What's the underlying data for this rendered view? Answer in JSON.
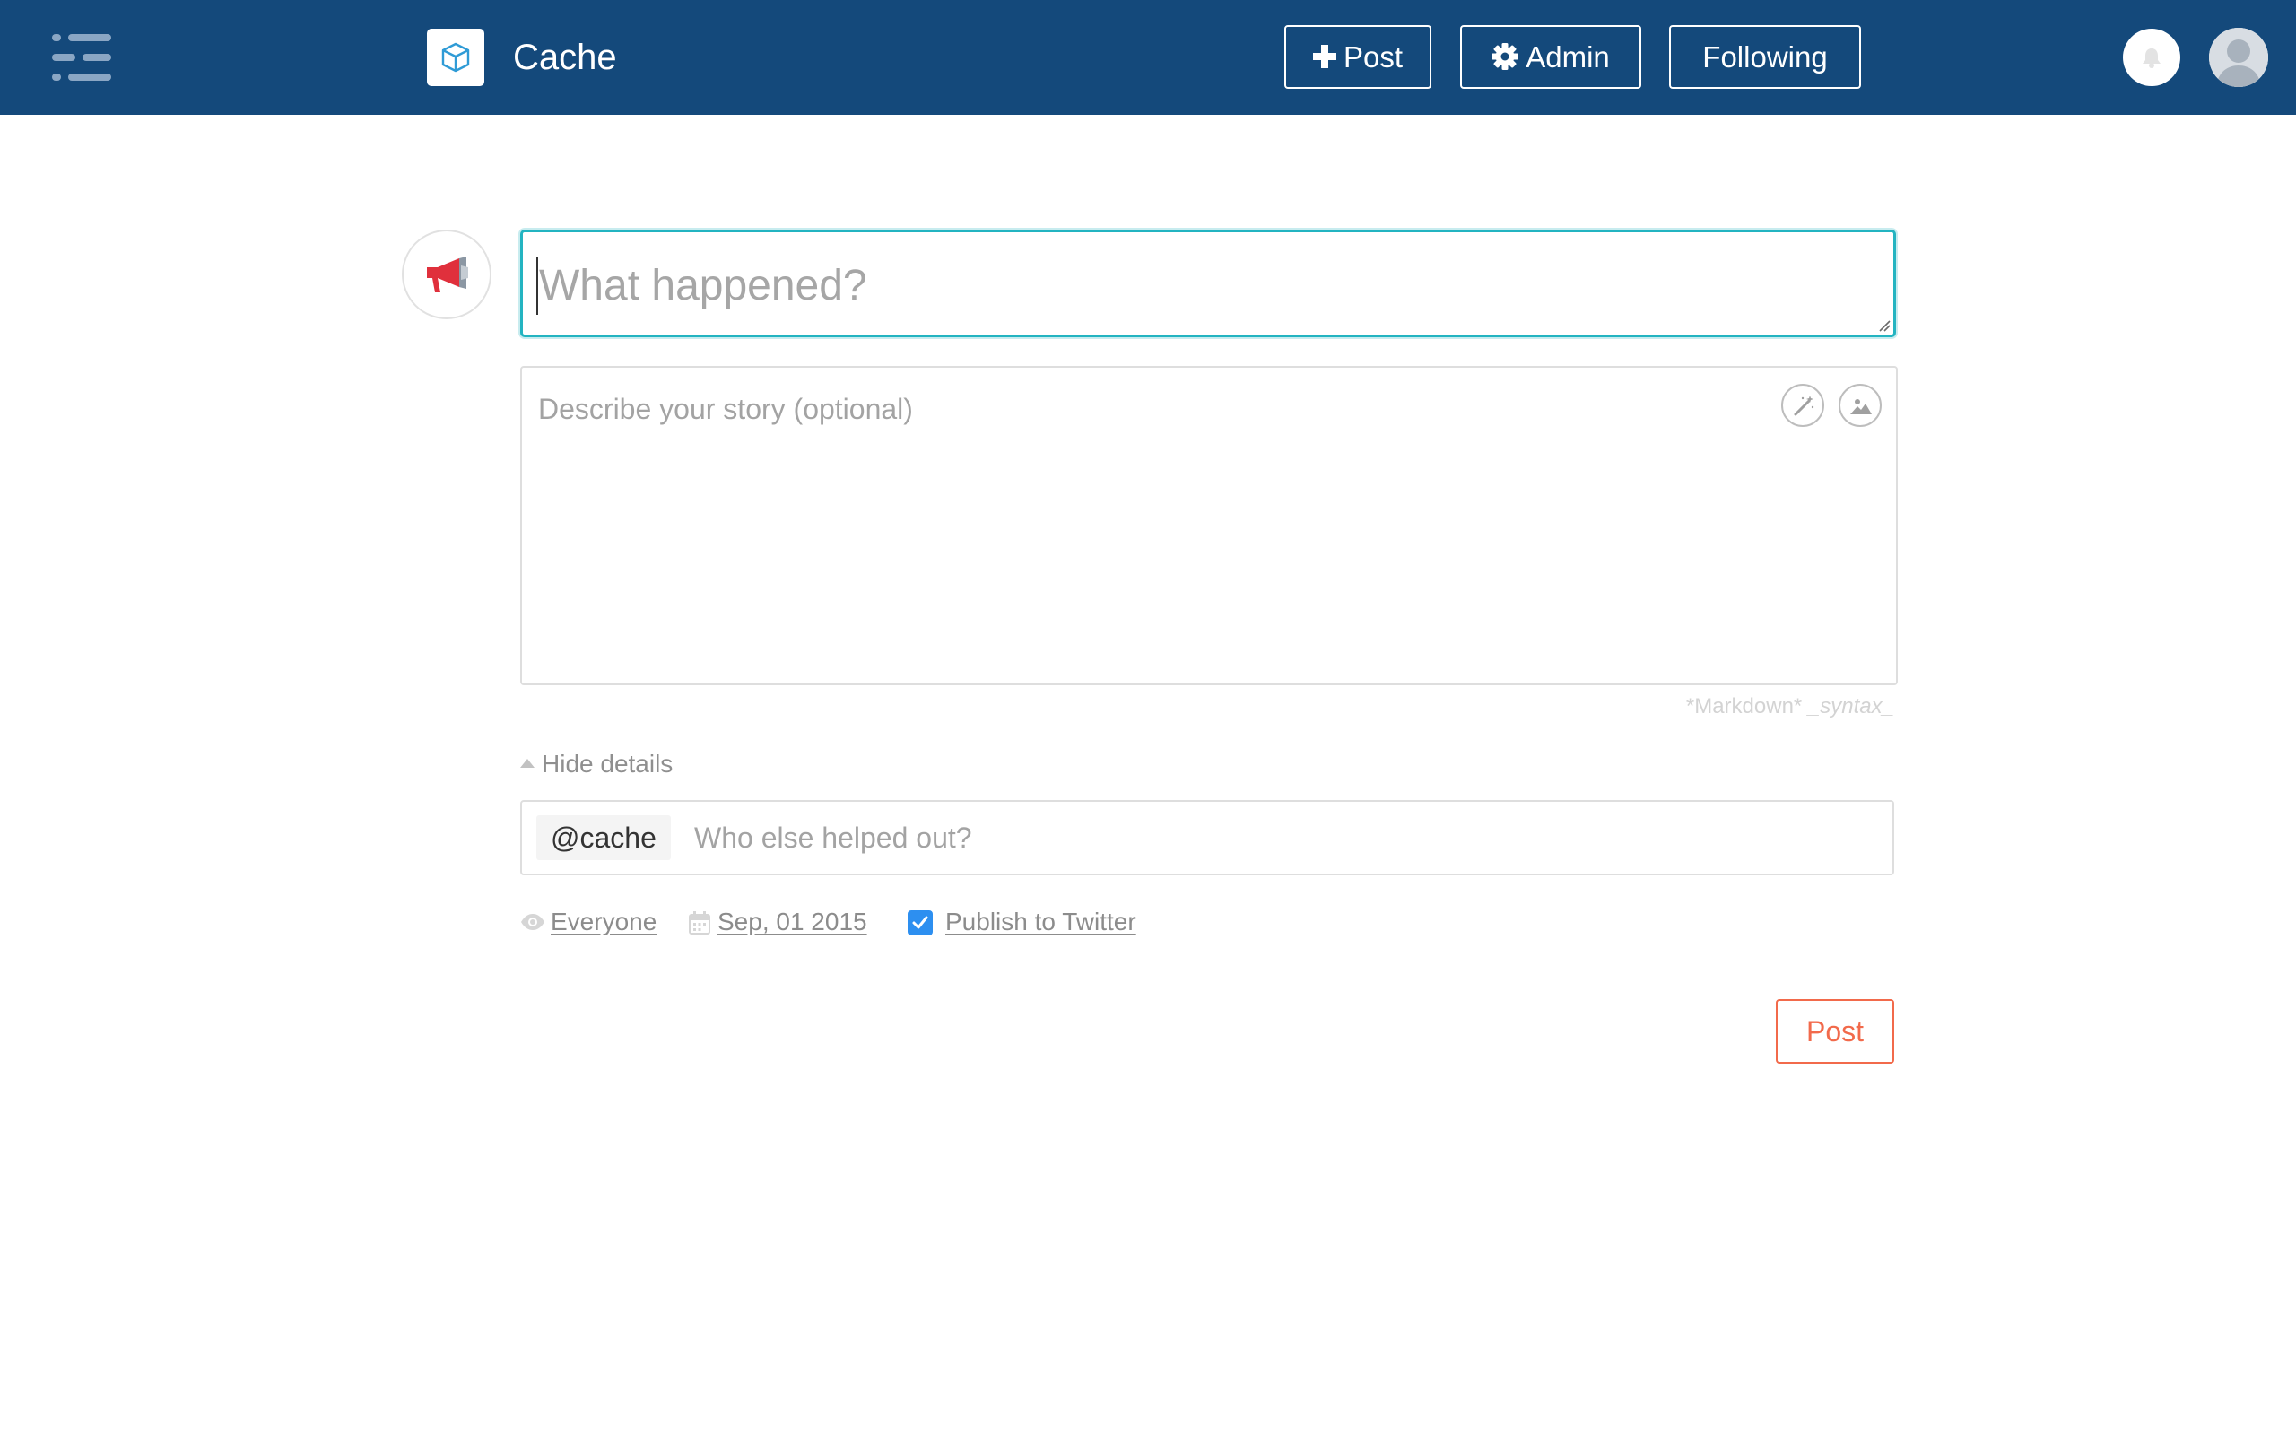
{
  "header": {
    "brand": "Cache",
    "post_label": "Post",
    "admin_label": "Admin",
    "following_label": "Following"
  },
  "composer": {
    "title_placeholder": "What happened?",
    "description_placeholder": "Describe your story (optional)",
    "markdown_hint_bold": "*Markdown*",
    "markdown_hint_italic": "_syntax_",
    "hide_details_label": "Hide details",
    "mention_tag": "@cache",
    "helpers_placeholder": "Who else helped out?",
    "visibility_label": "Everyone",
    "date_label": "Sep, 01 2015",
    "publish_twitter_label": "Publish to Twitter",
    "publish_twitter_checked": true,
    "submit_label": "Post"
  },
  "icons": {
    "menu": "menu-icon",
    "logo": "cube-icon",
    "plus": "plus-icon",
    "gear": "gear-icon",
    "bell": "bell-icon",
    "avatar": "user-avatar-icon",
    "megaphone": "megaphone-icon",
    "magic": "magic-wand-icon",
    "image": "image-icon",
    "eye": "eye-icon",
    "calendar": "calendar-icon",
    "check": "check-icon"
  },
  "colors": {
    "header_bg": "#14497b",
    "focus_border": "#23b4c1",
    "accent_red": "#f26a4b",
    "checkbox_blue": "#2d8ff0"
  }
}
